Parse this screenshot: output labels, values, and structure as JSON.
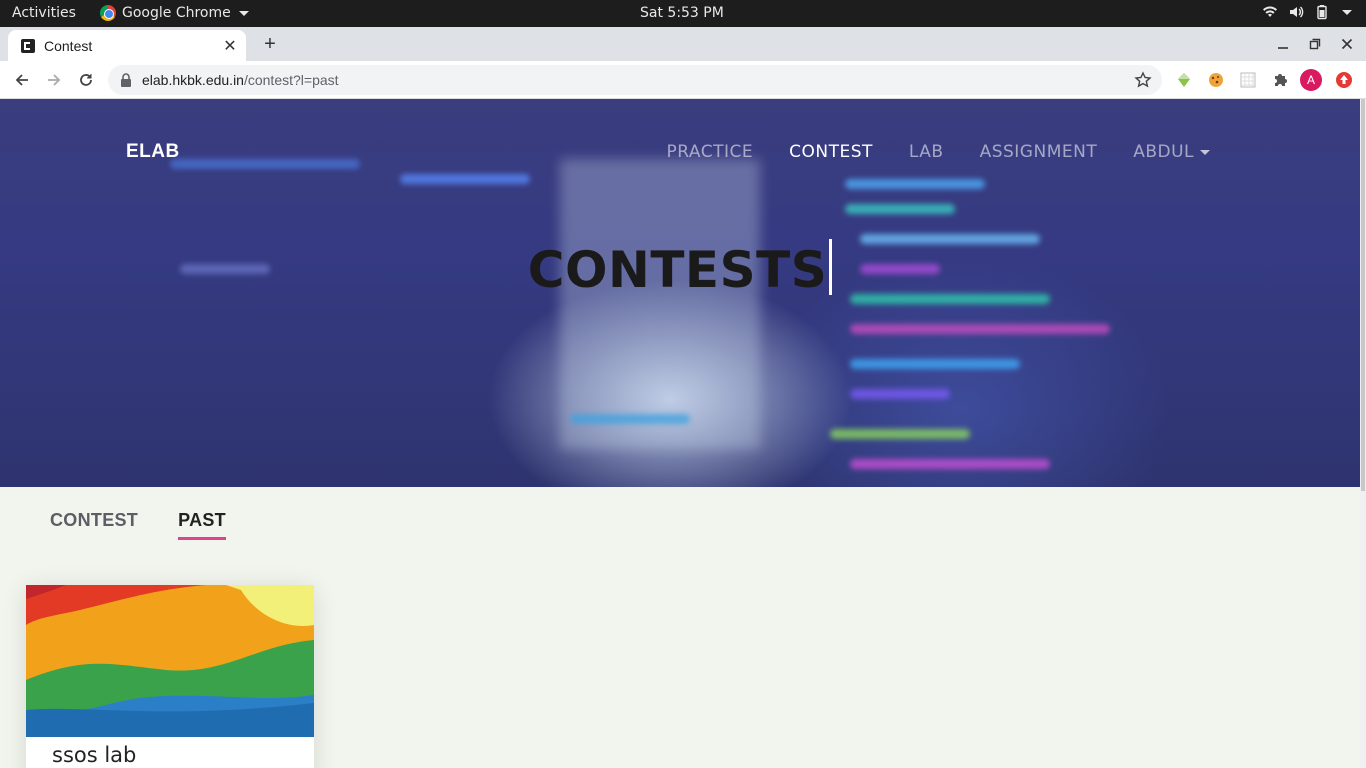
{
  "system": {
    "activities": "Activities",
    "app_name": "Google Chrome",
    "clock": "Sat  5:53 PM"
  },
  "browser": {
    "tab_title": "Contest",
    "url_host": "elab.hkbk.edu.in",
    "url_path": "/contest?l=past",
    "profile_initial": "A"
  },
  "site": {
    "brand": "ELAB",
    "nav": [
      "PRACTICE",
      "CONTEST",
      "LAB",
      "ASSIGNMENT",
      "ABDUL"
    ],
    "active_nav": "CONTEST",
    "hero_title": "CONTESTS"
  },
  "content": {
    "tabs": [
      "CONTEST",
      "PAST"
    ],
    "active_tab": "PAST",
    "cards": [
      {
        "title": "ssos lab"
      }
    ]
  },
  "colors": {
    "accent_underline": "#e0428f",
    "hero_bg": "#353a82"
  }
}
